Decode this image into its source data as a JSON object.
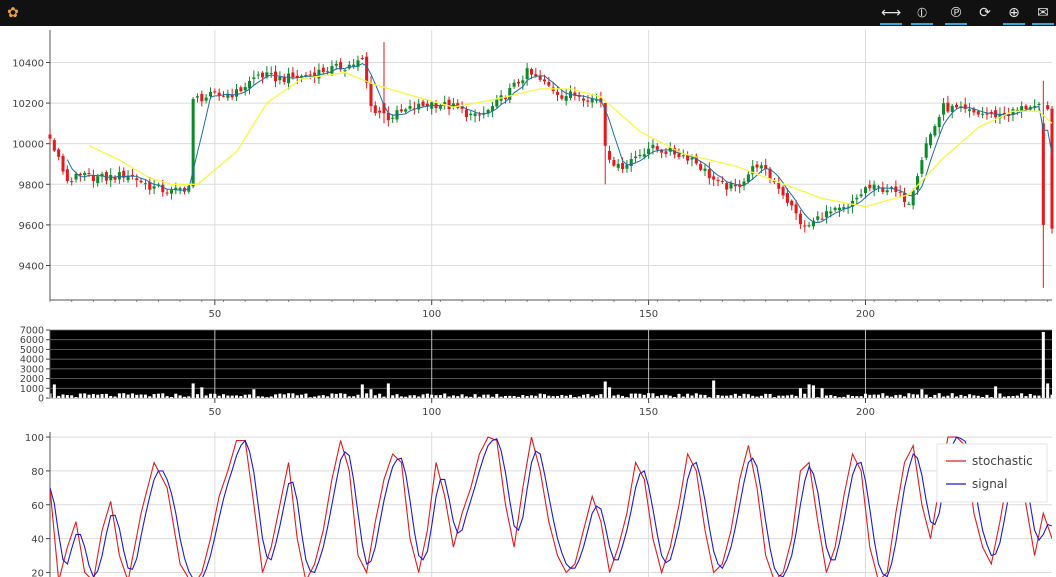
{
  "toolbar": {
    "tools": [
      {
        "name": "pan-icon",
        "glyph": "⟷",
        "active": true
      },
      {
        "name": "box-zoom-icon",
        "glyph": "⦶",
        "active": true
      },
      {
        "name": "wheel-zoom-icon",
        "glyph": "℗",
        "active": true
      },
      {
        "name": "reset-icon",
        "glyph": "⟳",
        "active": false
      },
      {
        "name": "crosshair-icon",
        "glyph": "⊕",
        "active": true
      },
      {
        "name": "hover-icon",
        "glyph": "✉",
        "active": true
      },
      {
        "name": "bokeh-logo-icon",
        "glyph": "✿",
        "active": false
      }
    ]
  },
  "colors": {
    "bull": "#0d8a2a",
    "bear": "#e31a1c",
    "sma_long": "#f7f740",
    "sma_short": "#1f6f9e",
    "volume_bg": "#000000",
    "volume_bar": "#ffffff",
    "stochastic": "#e31a1c",
    "signal": "#1a1ad6",
    "grid": "#dcdcdc",
    "toolbar_active": "#26aae1"
  },
  "chart_data": [
    {
      "type": "candlestick",
      "x_range": [
        12,
        243
      ],
      "ylim": [
        9230,
        10560
      ],
      "y_ticks": [
        "9400",
        "9600",
        "9800",
        "10000",
        "10200",
        "10400"
      ],
      "x_ticks": [
        "50",
        "100",
        "150",
        "200"
      ],
      "keypoints_x": [
        12,
        16,
        20,
        25,
        30,
        35,
        40,
        44,
        45,
        48,
        55,
        60,
        65,
        70,
        75,
        80,
        84,
        86,
        90,
        95,
        100,
        105,
        110,
        113,
        118,
        122,
        125,
        130,
        134,
        139,
        140,
        143,
        150,
        155,
        160,
        166,
        170,
        175,
        180,
        186,
        190,
        196,
        200,
        205,
        210,
        214,
        218,
        225,
        232,
        238,
        242,
        243
      ],
      "keypoints_close": [
        10020,
        9820,
        9840,
        9830,
        9850,
        9790,
        9760,
        9790,
        10220,
        10230,
        10250,
        10340,
        10320,
        10330,
        10360,
        10380,
        10410,
        10180,
        10130,
        10170,
        10200,
        10180,
        10130,
        10160,
        10260,
        10350,
        10310,
        10240,
        10240,
        10210,
        9970,
        9880,
        9980,
        9960,
        9930,
        9800,
        9780,
        9900,
        9790,
        9580,
        9650,
        9680,
        9780,
        9780,
        9720,
        10000,
        10180,
        10150,
        10140,
        10190,
        10160,
        9600
      ],
      "sma_long": {
        "x": [
          21,
          28,
          35,
          40,
          46,
          55,
          62,
          70,
          80,
          87,
          95,
          105,
          115,
          125,
          132,
          139,
          148,
          158,
          170,
          180,
          190,
          200,
          210,
          218,
          226,
          234,
          240,
          243
        ],
        "y": [
          9990,
          9920,
          9830,
          9800,
          9800,
          9960,
          10200,
          10320,
          10350,
          10290,
          10240,
          10180,
          10220,
          10270,
          10270,
          10230,
          10060,
          9950,
          9890,
          9810,
          9730,
          9690,
          9750,
          9930,
          10080,
          10160,
          10160,
          10100
        ]
      },
      "overrides": [
        {
          "i": 45,
          "o": 9790,
          "h": 10230,
          "l": 9780,
          "c": 10220
        },
        {
          "i": 89,
          "o": 10200,
          "h": 10500,
          "l": 10100,
          "c": 10150
        },
        {
          "i": 140,
          "o": 10200,
          "h": 10200,
          "l": 9800,
          "c": 9990
        },
        {
          "i": 241,
          "o": 10100,
          "h": 10310,
          "l": 9290,
          "c": 9600
        }
      ]
    },
    {
      "type": "bar",
      "ylim": [
        0,
        7000
      ],
      "y_ticks": [
        "0",
        "1000",
        "2000",
        "3000",
        "4000",
        "5000",
        "6000",
        "7000"
      ],
      "x_ticks": [
        "50",
        "100",
        "150",
        "200"
      ],
      "spikes": [
        {
          "i": 13,
          "v": 1400
        },
        {
          "i": 45,
          "v": 1500
        },
        {
          "i": 47,
          "v": 1100
        },
        {
          "i": 59,
          "v": 900
        },
        {
          "i": 84,
          "v": 1400
        },
        {
          "i": 86,
          "v": 900
        },
        {
          "i": 90,
          "v": 1500
        },
        {
          "i": 140,
          "v": 1700
        },
        {
          "i": 141,
          "v": 1100
        },
        {
          "i": 165,
          "v": 1800
        },
        {
          "i": 185,
          "v": 1000
        },
        {
          "i": 187,
          "v": 1400
        },
        {
          "i": 188,
          "v": 1300
        },
        {
          "i": 190,
          "v": 1000
        },
        {
          "i": 213,
          "v": 900
        },
        {
          "i": 230,
          "v": 1200
        },
        {
          "i": 241,
          "v": 6800
        },
        {
          "i": 242,
          "v": 1500
        }
      ]
    },
    {
      "type": "line",
      "ylim": [
        12,
        103
      ],
      "y_ticks": [
        "20",
        "40",
        "60",
        "80",
        "100"
      ],
      "legend": "top-right",
      "series": [
        {
          "name": "stochastic"
        },
        {
          "name": "signal"
        }
      ],
      "keypoints_x": [
        12,
        14,
        16,
        18,
        20,
        22,
        24,
        26,
        28,
        30,
        33,
        36,
        39,
        42,
        45,
        47,
        49,
        51,
        53,
        55,
        57,
        59,
        61,
        63,
        65,
        67,
        69,
        71,
        73,
        75,
        77,
        79,
        81,
        83,
        85,
        87,
        89,
        91,
        93,
        95,
        97,
        99,
        101,
        103,
        105,
        107,
        109,
        111,
        113,
        115,
        117,
        119,
        121,
        123,
        125,
        127,
        129,
        131,
        133,
        135,
        137,
        139,
        141,
        143,
        145,
        147,
        149,
        151,
        153,
        155,
        157,
        159,
        161,
        163,
        165,
        167,
        169,
        171,
        173,
        175,
        177,
        179,
        181,
        183,
        185,
        187,
        189,
        191,
        193,
        195,
        197,
        199,
        201,
        203,
        205,
        207,
        209,
        211,
        213,
        215,
        217,
        219,
        221,
        223,
        225,
        227,
        229,
        231,
        233,
        235,
        237,
        239,
        241,
        243
      ],
      "keypoints_stoch": [
        70,
        15,
        35,
        50,
        20,
        15,
        45,
        62,
        30,
        15,
        55,
        85,
        70,
        25,
        12,
        20,
        40,
        65,
        80,
        98,
        98,
        60,
        20,
        35,
        60,
        85,
        40,
        15,
        25,
        45,
        75,
        98,
        80,
        30,
        20,
        50,
        75,
        90,
        85,
        40,
        20,
        45,
        85,
        65,
        35,
        55,
        70,
        90,
        100,
        98,
        60,
        35,
        70,
        100,
        80,
        50,
        30,
        20,
        25,
        45,
        65,
        50,
        20,
        35,
        55,
        85,
        75,
        40,
        20,
        35,
        60,
        90,
        80,
        45,
        20,
        25,
        45,
        75,
        95,
        70,
        30,
        15,
        20,
        40,
        80,
        85,
        50,
        20,
        35,
        65,
        90,
        80,
        35,
        15,
        20,
        55,
        85,
        95,
        60,
        40,
        70,
        100,
        100,
        95,
        55,
        35,
        25,
        50,
        80,
        90,
        60,
        30,
        55,
        40
      ],
      "signal_lag": 1
    }
  ]
}
